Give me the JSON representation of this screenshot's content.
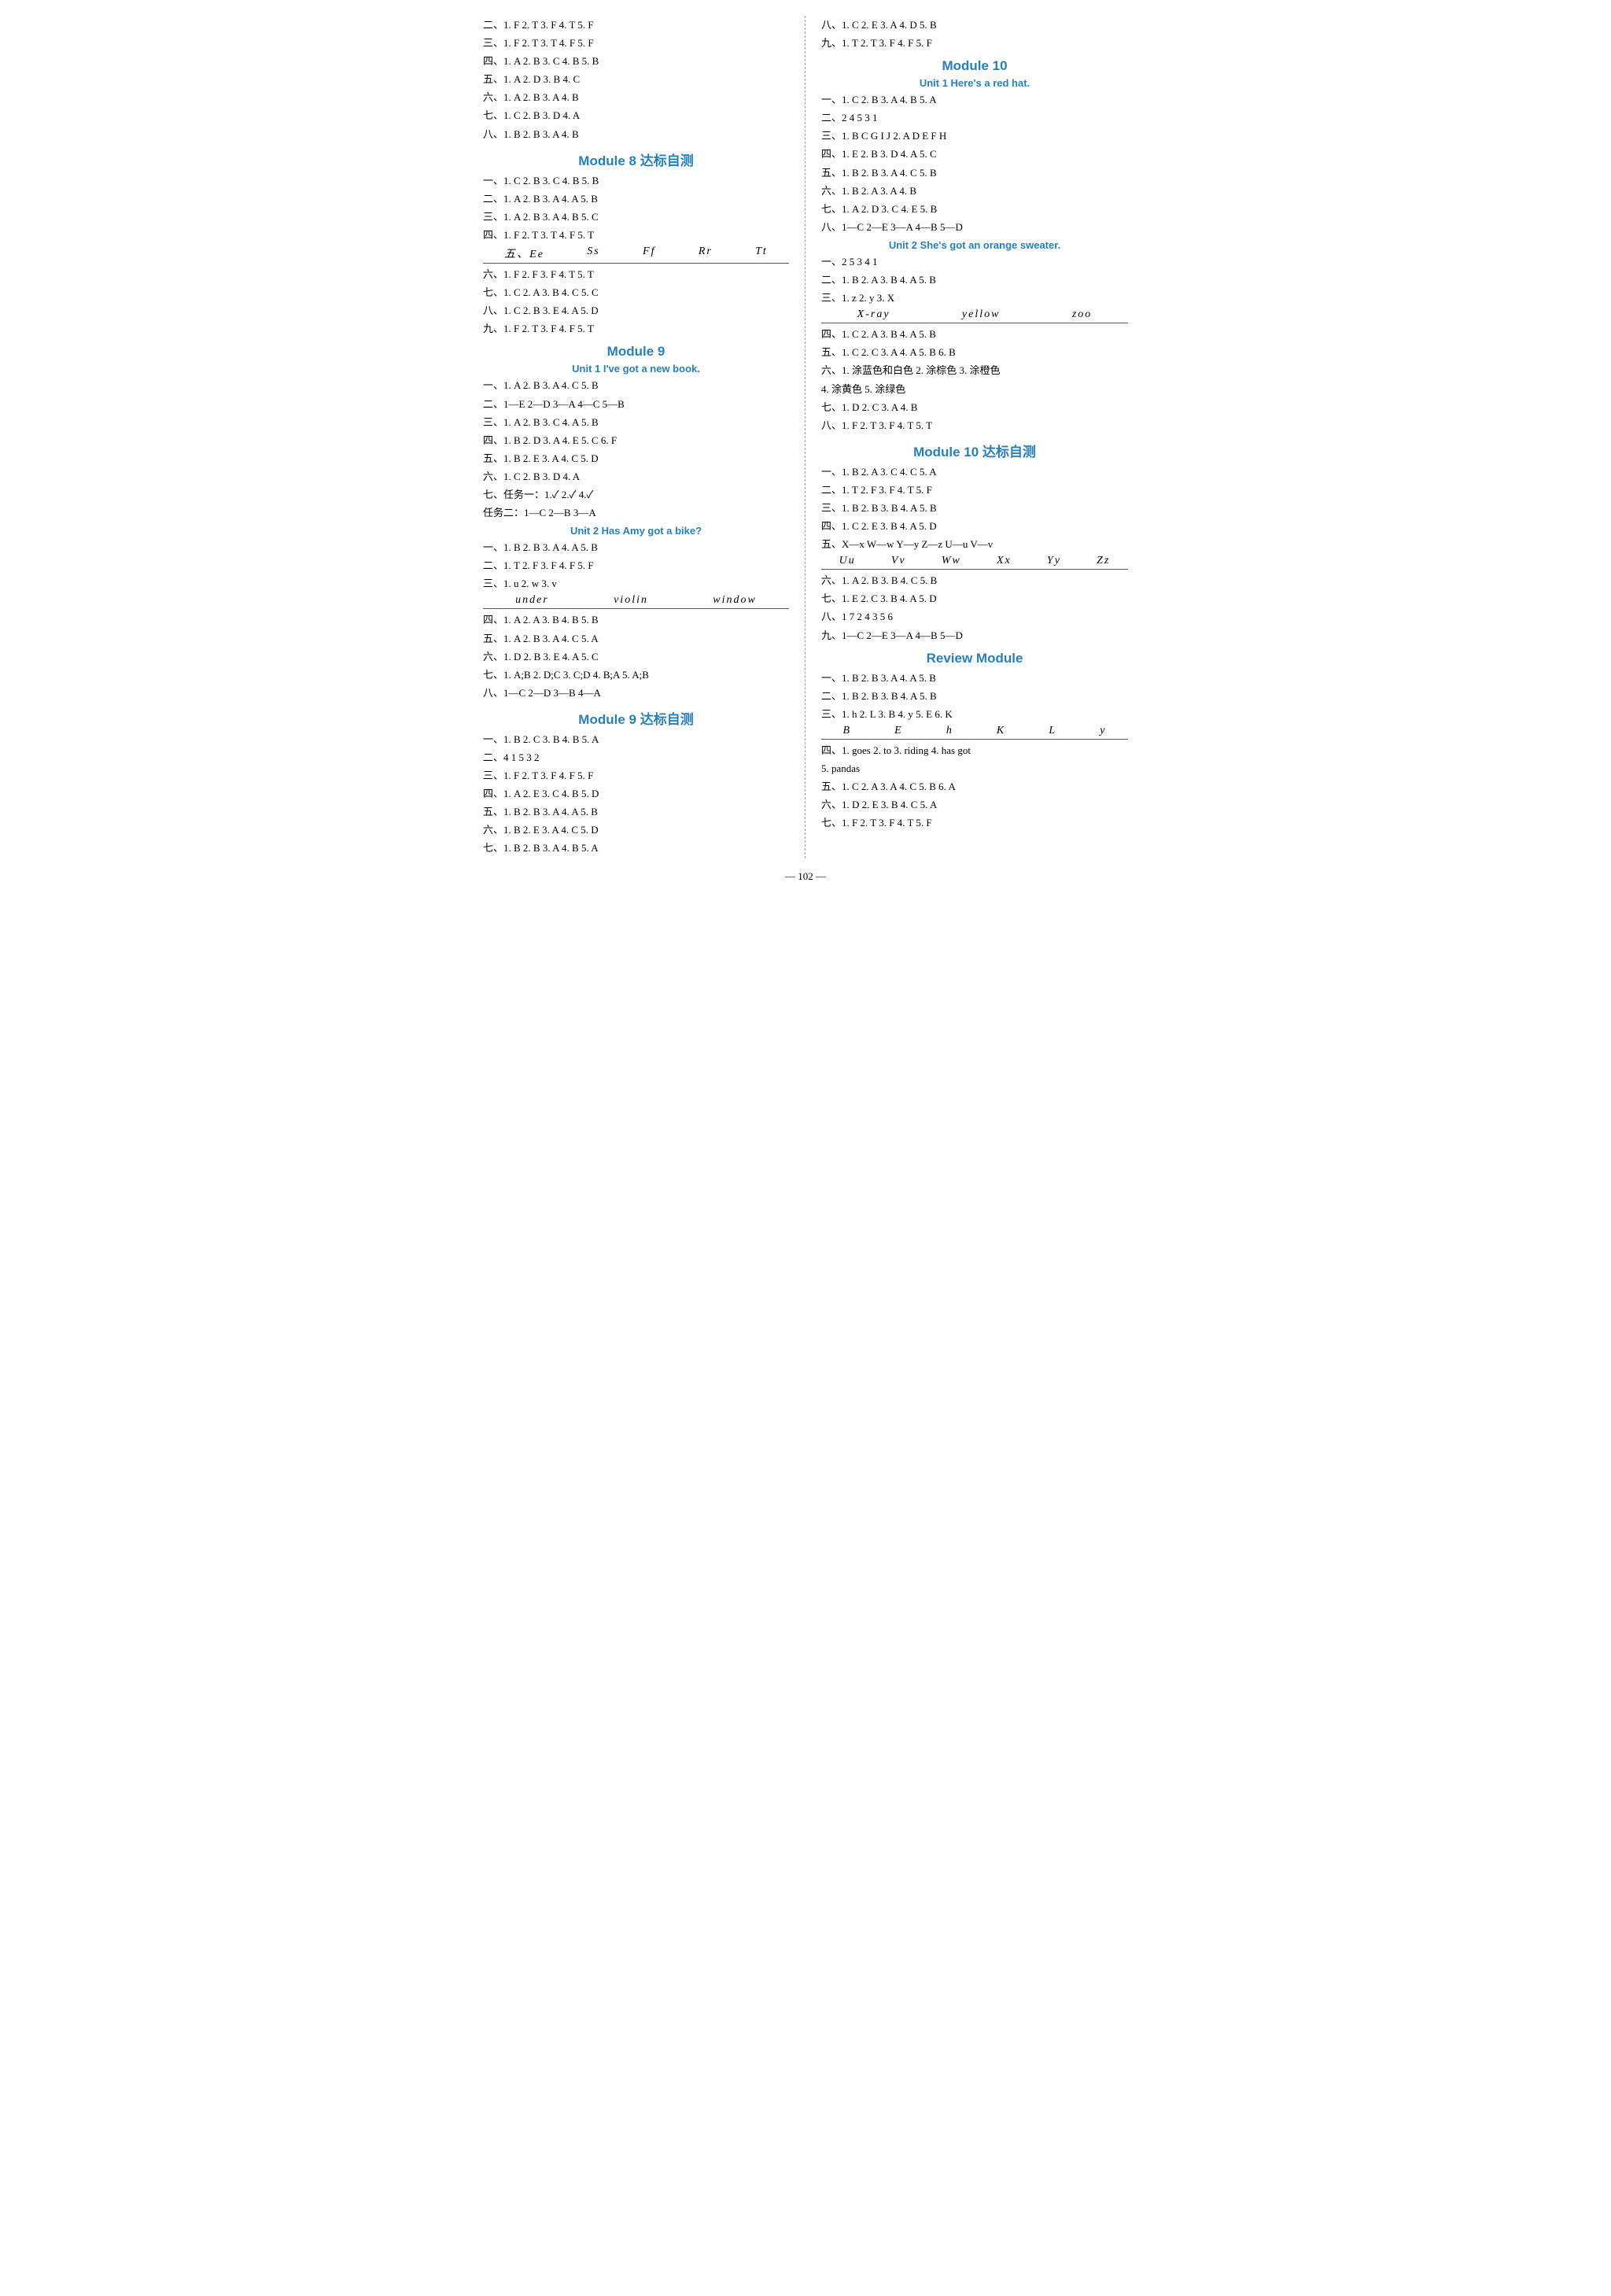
{
  "page_number": "— 102 —",
  "left_col": [
    {
      "type": "line",
      "text": "二、1. F  2. T  3. F  4. T  5. F"
    },
    {
      "type": "line",
      "text": "三、1. F  2. T  3. T  4. F  5. F"
    },
    {
      "type": "line",
      "text": "四、1. A  2. B  3. C  4. B  5. B"
    },
    {
      "type": "line",
      "text": "五、1. A  2. D  3. B  4. C"
    },
    {
      "type": "line",
      "text": "六、1. A  2. B  3. A  4. B"
    },
    {
      "type": "line",
      "text": "七、1. C  2. B  3. D  4. A"
    },
    {
      "type": "line",
      "text": "八、1. B  2. B  3. A  4. B"
    },
    {
      "type": "module",
      "text": "Module 8  达标自测"
    },
    {
      "type": "line",
      "text": "一、1. C  2. B  3. C  4. B  5. B"
    },
    {
      "type": "line",
      "text": "二、1. A  2. B  3. A  4. A  5. B"
    },
    {
      "type": "line",
      "text": "三、1. A  2. B  3. A  4. B  5. C"
    },
    {
      "type": "line",
      "text": "四、1. F  2. T  3. T  4. F  5. T"
    },
    {
      "type": "underline",
      "items": [
        "五、Ee",
        "Ss",
        "Ff",
        "Rr",
        "Tt"
      ]
    },
    {
      "type": "line",
      "text": "六、1. F  2. F  3. F  4. T  5. T"
    },
    {
      "type": "line",
      "text": "七、1. C  2. A  3. B  4. C  5. C"
    },
    {
      "type": "line",
      "text": "八、1. C  2. B  3. E  4. A  5. D"
    },
    {
      "type": "line",
      "text": "九、1. F  2. T  3. F  4. F  5. T"
    },
    {
      "type": "module",
      "text": "Module 9"
    },
    {
      "type": "unit",
      "text": "Unit 1  I've got a new book."
    },
    {
      "type": "line",
      "text": "一、1. A  2. B  3. A  4. C  5. B"
    },
    {
      "type": "line",
      "text": "二、1—E  2—D  3—A  4—C  5—B"
    },
    {
      "type": "line",
      "text": "三、1. A  2. B  3. C  4. A  5. B"
    },
    {
      "type": "line",
      "text": "四、1. B  2. D  3. A  4. E  5. C  6. F"
    },
    {
      "type": "line",
      "text": "五、1. B  2. E  3. A  4. C  5. D"
    },
    {
      "type": "line",
      "text": "六、1. C  2. B  3. D  4. A"
    },
    {
      "type": "line",
      "text": "七、任务一：1.✓  2.✓  4.✓"
    },
    {
      "type": "line",
      "text": "     任务二：1—C  2—B  3—A"
    },
    {
      "type": "unit",
      "text": "Unit 2  Has Amy got a bike?"
    },
    {
      "type": "line",
      "text": "一、1. B  2. B  3. A  4. A  5. B"
    },
    {
      "type": "line",
      "text": "二、1. T  2. F  3. F  4. F  5. F"
    },
    {
      "type": "line",
      "text": "三、1. u  2. w  3. v"
    },
    {
      "type": "underline",
      "items": [
        "under",
        "violin",
        "window"
      ]
    },
    {
      "type": "line",
      "text": "四、1. A  2. A  3. B  4. B  5. B"
    },
    {
      "type": "line",
      "text": "五、1. A  2. B  3. A  4. C  5. A"
    },
    {
      "type": "line",
      "text": "六、1. D  2. B  3. E  4. A  5. C"
    },
    {
      "type": "line",
      "text": "七、1. A;B  2. D;C  3. C;D  4. B;A  5. A;B"
    },
    {
      "type": "line",
      "text": "八、1—C  2—D  3—B  4—A"
    },
    {
      "type": "module",
      "text": "Module 9  达标自测"
    },
    {
      "type": "line",
      "text": "一、1. B  2. C  3. B  4. B  5. A"
    },
    {
      "type": "line",
      "text": "二、4  1  5  3  2"
    },
    {
      "type": "line",
      "text": "三、1. F  2. T  3. F  4. F  5. F"
    },
    {
      "type": "line",
      "text": "四、1. A  2. E  3. C  4. B  5. D"
    },
    {
      "type": "line",
      "text": "五、1. B  2. B  3. A  4. A  5. B"
    },
    {
      "type": "line",
      "text": "六、1. B  2. E  3. A  4. C  5. D"
    },
    {
      "type": "line",
      "text": "七、1. B  2. B  3. A  4. B  5. A"
    }
  ],
  "right_col": [
    {
      "type": "line",
      "text": "八、1. C  2. E  3. A  4. D  5. B"
    },
    {
      "type": "line",
      "text": "九、1. T  2. T  3. F  4. F  5. F"
    },
    {
      "type": "module",
      "text": "Module 10"
    },
    {
      "type": "unit",
      "text": "Unit 1  Here's a red hat."
    },
    {
      "type": "line",
      "text": "一、1. C  2. B  3. A  4. B  5. A"
    },
    {
      "type": "line",
      "text": "二、2  4  5  3  1"
    },
    {
      "type": "line",
      "text": "三、1. B C G I J  2. A D E F H"
    },
    {
      "type": "line",
      "text": "四、1. E  2. B  3. D  4. A  5. C"
    },
    {
      "type": "line",
      "text": "五、1. B  2. B  3. A  4. C  5. B"
    },
    {
      "type": "line",
      "text": "六、1. B  2. A  3. A  4. B"
    },
    {
      "type": "line",
      "text": "七、1. A  2. D  3. C  4. E  5. B"
    },
    {
      "type": "line",
      "text": "八、1—C  2—E  3—A  4—B  5—D"
    },
    {
      "type": "unit",
      "text": "Unit 2  She's got an orange sweater."
    },
    {
      "type": "line",
      "text": "一、2  5  3  4  1"
    },
    {
      "type": "line",
      "text": "二、1. B  2. A  3. B  4. A  5. B"
    },
    {
      "type": "line",
      "text": "三、1. z  2. y  3. X"
    },
    {
      "type": "underline",
      "items": [
        "X-ray",
        "yellow",
        "zoo"
      ]
    },
    {
      "type": "line",
      "text": "四、1. C  2. A  3. B  4. A  5. B"
    },
    {
      "type": "line",
      "text": "五、1. C  2. C  3. A  4. A  5. B  6. B"
    },
    {
      "type": "line",
      "text": "六、1. 涂蓝色和白色  2. 涂棕色  3. 涂橙色"
    },
    {
      "type": "line",
      "text": "     4. 涂黄色  5. 涂绿色"
    },
    {
      "type": "line",
      "text": "七、1. D  2. C  3. A  4. B"
    },
    {
      "type": "line",
      "text": "八、1. F  2. T  3. F  4. T  5. T"
    },
    {
      "type": "module",
      "text": "Module 10  达标自测"
    },
    {
      "type": "line",
      "text": "一、1. B  2. A  3. C  4. C  5. A"
    },
    {
      "type": "line",
      "text": "二、1. T  2. F  3. F  4. T  5. F"
    },
    {
      "type": "line",
      "text": "三、1. B  2. B  3. B  4. A  5. B"
    },
    {
      "type": "line",
      "text": "四、1. C  2. E  3. B  4. A  5. D"
    },
    {
      "type": "line",
      "text": "五、X—x  W—w  Y—y  Z—z  U—u  V—v"
    },
    {
      "type": "underline",
      "items": [
        "Uu",
        "Vv",
        "Ww",
        "Xx",
        "Yy",
        "Zz"
      ]
    },
    {
      "type": "line",
      "text": "六、1. A  2. B  3. B  4. C  5. B"
    },
    {
      "type": "line",
      "text": "七、1. E  2. C  3. B  4. A  5. D"
    },
    {
      "type": "line",
      "text": "八、1  7  2  4  3  5  6"
    },
    {
      "type": "line",
      "text": "九、1—C  2—E  3—A  4—B  5—D"
    },
    {
      "type": "module",
      "text": "Review Module"
    },
    {
      "type": "line",
      "text": "一、1. B  2. B  3. A  4. A  5. B"
    },
    {
      "type": "line",
      "text": "二、1. B  2. B  3. B  4. A  5. B"
    },
    {
      "type": "line",
      "text": "三、1. h  2. L  3. B  4. y  5. E  6. K"
    },
    {
      "type": "underline",
      "items": [
        "B",
        "E",
        "h",
        "K",
        "L",
        "y"
      ]
    },
    {
      "type": "line",
      "text": "四、1. goes  2. to  3. riding  4. has got"
    },
    {
      "type": "line",
      "text": "     5. pandas"
    },
    {
      "type": "line",
      "text": "五、1. C  2. A  3. A  4. C  5. B  6. A"
    },
    {
      "type": "line",
      "text": "六、1. D  2. E  3. B  4. C  5. A"
    },
    {
      "type": "line",
      "text": "七、1. F  2. T  3. F  4. T  5. F"
    }
  ]
}
